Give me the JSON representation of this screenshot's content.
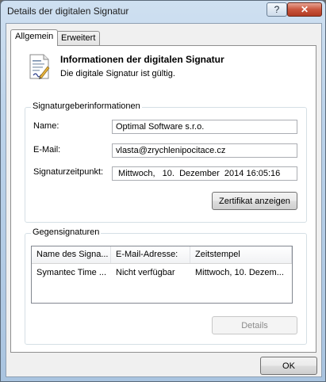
{
  "window": {
    "title": "Details der digitalen Signatur",
    "help_glyph": "?",
    "close_glyph": "✕"
  },
  "tabs": [
    {
      "label": "Allgemein"
    },
    {
      "label": "Erweitert"
    }
  ],
  "header": {
    "title": "Informationen der digitalen Signatur",
    "subtitle": "Die digitale Signatur ist gültig.",
    "icon": "certificate-icon"
  },
  "signer": {
    "legend": "Signaturgeberinformationen",
    "name_label": "Name:",
    "name_value": "Optimal Software s.r.o.",
    "email_label": "E-Mail:",
    "email_value": "vlasta@zrychlenipocitace.cz",
    "timestamp_label": "Signaturzeitpunkt:",
    "timestamp_value": " Mittwoch,   10.  Dezember  2014 16:05:16",
    "view_cert_button": "Zertifikat anzeigen"
  },
  "countersignatures": {
    "legend": "Gegensignaturen",
    "columns": [
      "Name des Signa...",
      "E-Mail-Adresse:",
      "Zeitstempel"
    ],
    "rows": [
      [
        "Symantec Time ...",
        "Nicht verfügbar",
        "Mittwoch, 10. Dezem..."
      ]
    ],
    "details_button": "Details"
  },
  "footer": {
    "ok_button": "OK"
  }
}
